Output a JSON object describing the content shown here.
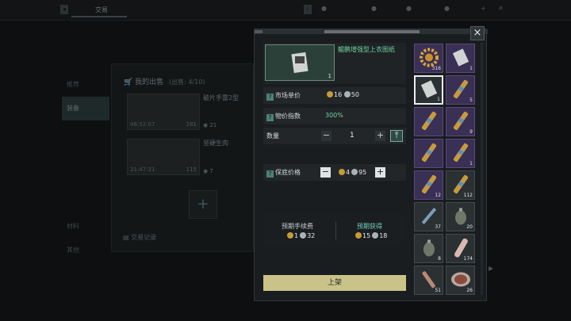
{
  "topbar": {
    "active_tab": "交易"
  },
  "left": {
    "nav": [
      "推荐",
      "装备"
    ],
    "nav_bottom": [
      "材料",
      "其他"
    ],
    "sales_title": "我的出售",
    "sales_count": "(出售: 4/10)",
    "sales": [
      {
        "name": "破片手雷2型",
        "time": "46:52:07",
        "count": "281",
        "price": "21"
      },
      {
        "name": "坚硬生肉",
        "time": "21:47:31",
        "count": "115",
        "price": "7"
      }
    ],
    "trade_record": "交易记录"
  },
  "panel": {
    "item_name": "鲲鹏增强型上衣图纸",
    "item_count": "1",
    "market_price_label": "市场单价",
    "market_price_gold": "16",
    "market_price_silver": "50",
    "price_index_label": "物价指数",
    "price_index_value": "300%",
    "quantity_label": "数量",
    "quantity_value": "1",
    "min_price_label": "保底价格",
    "min_price_gold": "4",
    "min_price_silver": "95",
    "fee_label": "预期手续费",
    "fee_gold": "1",
    "fee_silver": "32",
    "income_label": "预期获得",
    "income_gold": "15",
    "income_silver": "18",
    "list_button": "上架",
    "close_symbol": "×"
  },
  "inventory": [
    {
      "n": "316",
      "tone": "purple",
      "icon": "gear-icon"
    },
    {
      "n": "1",
      "tone": "purple",
      "icon": "blueprint-icon"
    },
    {
      "n": "1",
      "tone": "grey",
      "icon": "blueprint-icon",
      "selected": true
    },
    {
      "n": "5",
      "tone": "purple",
      "icon": "cartridge-icon"
    },
    {
      "n": "",
      "tone": "purple",
      "icon": "cartridge-icon"
    },
    {
      "n": "9",
      "tone": "purple",
      "icon": "cartridge-icon"
    },
    {
      "n": "",
      "tone": "purple",
      "icon": "cartridge-icon"
    },
    {
      "n": "1",
      "tone": "purple",
      "icon": "cartridge-icon"
    },
    {
      "n": "12",
      "tone": "purple",
      "icon": "cartridge-icon"
    },
    {
      "n": "112",
      "tone": "grey",
      "icon": "cartridge-icon"
    },
    {
      "n": "37",
      "tone": "grey",
      "icon": "syringe-icon"
    },
    {
      "n": "20",
      "tone": "grey",
      "icon": "grenade-icon"
    },
    {
      "n": "8",
      "tone": "grey",
      "icon": "grenade-icon"
    },
    {
      "n": "174",
      "tone": "grey",
      "icon": "shell-icon"
    },
    {
      "n": "51",
      "tone": "grey",
      "icon": "flare-icon"
    },
    {
      "n": "26",
      "tone": "grey",
      "icon": "meat-icon"
    }
  ]
}
